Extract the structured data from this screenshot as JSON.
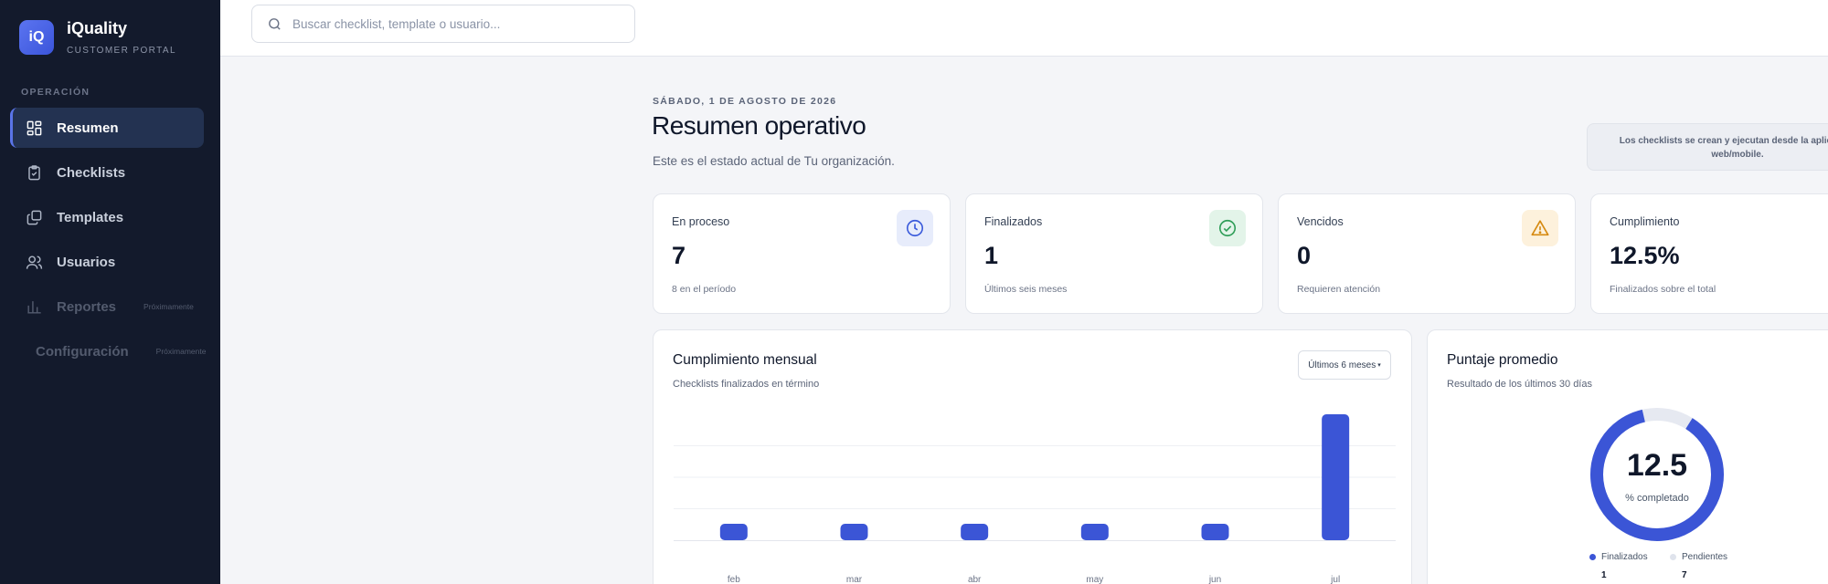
{
  "brand": {
    "logo": "iQ",
    "name": "iQuality",
    "subtitle": "CUSTOMER PORTAL"
  },
  "sidebar": {
    "section_title": "OPERACIÓN",
    "items": [
      {
        "label": "Resumen",
        "icon": "dashboard-icon",
        "active": true
      },
      {
        "label": "Checklists",
        "icon": "clipboard-icon"
      },
      {
        "label": "Templates",
        "icon": "templates-icon"
      },
      {
        "label": "Usuarios",
        "icon": "users-icon"
      },
      {
        "label": "Reportes",
        "icon": "bar-chart-icon",
        "badge": "Próximamente",
        "disabled": true
      },
      {
        "label": "Configuración",
        "icon": "dot-icon",
        "badge": "Próximamente",
        "disabled": true
      }
    ]
  },
  "search": {
    "placeholder": "Buscar checklist, template o usuario..."
  },
  "header": {
    "date": "SÁBADO, 1 DE AGOSTO DE 2026",
    "title": "Resumen operativo",
    "subtitle": "Este es el estado actual de Tu organización.",
    "info_line1": "Los checklists se crean y ejecutan desde la aplicación",
    "info_line2": "web/mobile."
  },
  "stats": [
    {
      "label": "En proceso",
      "value": "7",
      "note": "8 en el período",
      "icon": "clock-icon",
      "color": "#3b5bdb"
    },
    {
      "label": "Finalizados",
      "value": "1",
      "note": "Últimos seis meses",
      "icon": "check-circle-icon",
      "color": "#2f9e58"
    },
    {
      "label": "Vencidos",
      "value": "0",
      "note": "Requieren atención",
      "icon": "warning-icon",
      "color": "#d68a10"
    },
    {
      "label": "Cumplimiento",
      "value": "12.5%",
      "note": "Finalizados sobre el total",
      "icon": "",
      "color": ""
    }
  ],
  "monthly": {
    "title": "Cumplimiento mensual",
    "subtitle": "Checklists finalizados en término",
    "period_button": "Últimos 6 meses"
  },
  "score": {
    "title": "Puntaje promedio",
    "subtitle": "Resultado de los últimos 30 días",
    "value": "12.5",
    "value_label": "% completado",
    "legend": [
      {
        "label": "Finalizados",
        "count": "1",
        "color": "#3b55d6"
      },
      {
        "label": "Pendientes",
        "count": "7",
        "color": "#dfe3ec"
      }
    ]
  },
  "chart_data": {
    "type": "bar",
    "categories": [
      "feb",
      "mar",
      "abr",
      "may",
      "jun",
      "jul"
    ],
    "values": [
      0.13,
      0.13,
      0.13,
      0.13,
      0.13,
      1
    ],
    "ylim": [
      0,
      1
    ],
    "grid": true,
    "color": "#3b55d6"
  },
  "donut": {
    "fraction": 0.875,
    "color": "#3b55d6",
    "track": "#e6e9f1"
  }
}
